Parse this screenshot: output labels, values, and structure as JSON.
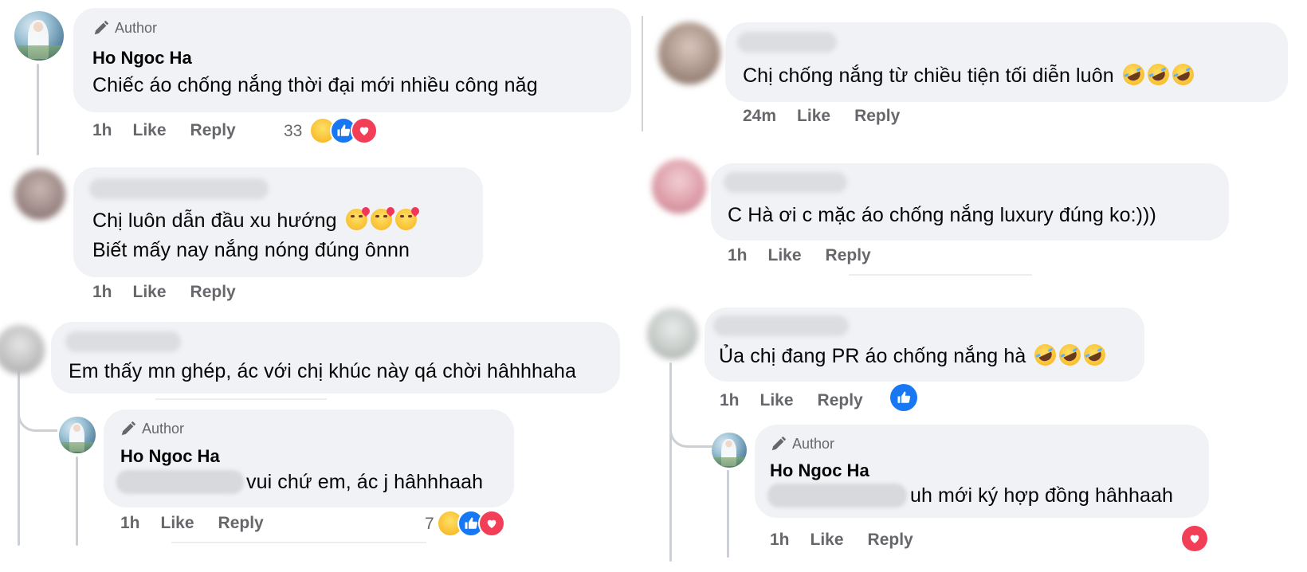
{
  "labels": {
    "author": "Author",
    "like": "Like",
    "reply": "Reply"
  },
  "icons": [
    "pencil-icon",
    "haha-reaction-icon",
    "like-reaction-icon",
    "love-reaction-icon",
    "rofl-emoji-icon",
    "kissing-heart-emoji-icon"
  ],
  "colors": {
    "bubble": "#f0f2f5",
    "muted_text": "#65676b",
    "like_blue": "#1877f2",
    "love_red": "#f33e58"
  },
  "left": {
    "c1": {
      "name": "Ho Ngoc Ha",
      "text": "Chiếc áo chống nắng thời đại mới nhiều công năg",
      "time": "1h",
      "reaction_count": "33"
    },
    "c2": {
      "line1": "Chị luôn dẫn đầu xu hướng",
      "line2": "Biết mấy nay nắng nóng đúng ônnn",
      "time": "1h"
    },
    "c3": {
      "text": "Em thấy mn ghép, ác với chị khúc này qá chời hâhhhaha"
    },
    "c3_reply": {
      "name": "Ho Ngoc Ha",
      "text": "vui chứ em, ác j hâhhhaah",
      "time": "1h",
      "reaction_count": "7"
    }
  },
  "right": {
    "c1": {
      "text": "Chị chống nắng từ chiều tiện tối diễn luôn",
      "time": "24m"
    },
    "c2": {
      "text": "C Hà ơi c mặc áo chống nắng luxury đúng ko:)))",
      "time": "1h"
    },
    "c3": {
      "text": "Ủa chị đang PR áo chống nắng hà",
      "time": "1h"
    },
    "c3_reply": {
      "name": "Ho Ngoc Ha",
      "text": "uh mới ký hợp đồng hâhhaah",
      "time": "1h"
    }
  }
}
